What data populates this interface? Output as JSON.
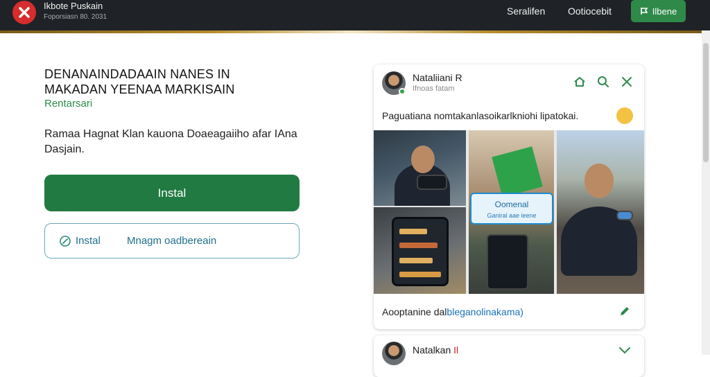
{
  "header": {
    "brand_title": "Ikbote Puskain",
    "brand_sub": "Foporsiasn 80. 2031",
    "nav": [
      "Seralifen",
      "Ootiocebit"
    ],
    "action_button": "Ilbene"
  },
  "hero": {
    "headline_line1": "DENANAINDADAAIN NANES IN",
    "headline_line2": "MAKADAN YEENAA MARKISAIN",
    "subtitle": "Rentarsari",
    "description": "Ramaa Hagnat Klan kauona Doaeagaiiho afar IAna Dasjain.",
    "primary_button": "Instal",
    "secondary_button_label1": "Instal",
    "secondary_button_label2": "Mnagm oadbereain"
  },
  "post": {
    "author": "Nataliiani R",
    "meta": "Ifnoas fatam",
    "text": "Paguatiana nomtakanlasoikarlkniohi lipatokai.",
    "overlay_title": "Oomenal",
    "overlay_sub": "Ganiral aae ieene",
    "footer_text": "Aooptanine dal",
    "footer_link": "bleganolinakama)"
  },
  "post2": {
    "author": "Natalkan",
    "author_suffix": "Il"
  },
  "colors": {
    "topbar": "#1f2327",
    "primary_green": "#217a41",
    "accent_link": "#1e6f8e",
    "logo_red": "#d72d2d"
  }
}
